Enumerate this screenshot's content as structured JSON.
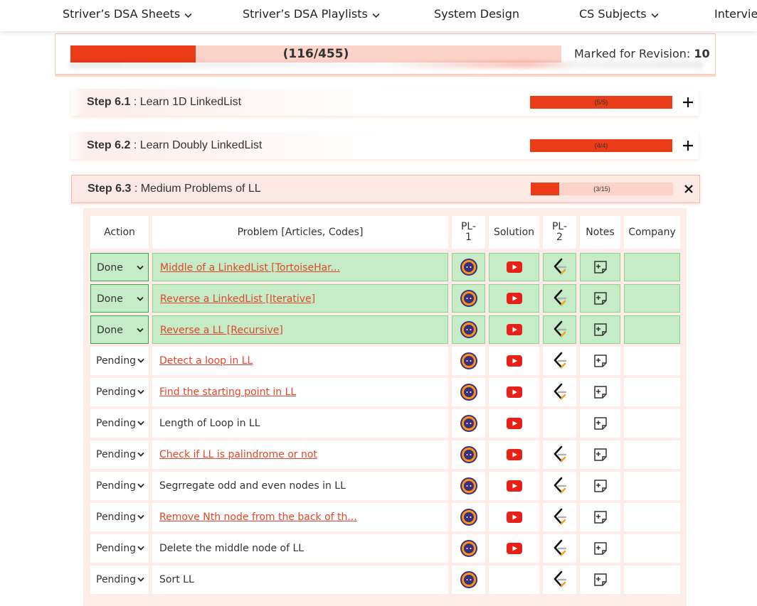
{
  "nav": [
    {
      "label": "Striver’s DSA Sheets",
      "dropdown": true
    },
    {
      "label": "Striver’s DSA Playlists",
      "dropdown": true
    },
    {
      "label": "System Design",
      "dropdown": false
    },
    {
      "label": "CS Subjects",
      "dropdown": true
    },
    {
      "label": "Intervie",
      "dropdown": false
    }
  ],
  "progress": {
    "text": "(116/455)",
    "done": 116,
    "total": 455,
    "revision_label": "Marked for Revision:",
    "revision_count": "10"
  },
  "steps": [
    {
      "num": "Step 6.1",
      "title": ": Learn 1D LinkedList",
      "progress": "(5/5)",
      "fraction": 1.0,
      "expanded": false
    },
    {
      "num": "Step 6.2",
      "title": ": Learn Doubly LinkedList",
      "progress": "(4/4)",
      "fraction": 1.0,
      "expanded": false
    },
    {
      "num": "Step 6.3",
      "title": ": Medium Problems of LL",
      "progress": "(3/15)",
      "fraction": 0.2,
      "expanded": true
    }
  ],
  "table": {
    "headers": {
      "action": "Action",
      "problem": "Problem [Articles, Codes]",
      "pl1": "PL-\n1",
      "solution": "Solution",
      "pl2": "PL-\n2",
      "notes": "Notes",
      "company": "Company"
    },
    "rows": [
      {
        "status": "Done",
        "problem": "Middle of a LinkedList [TortoiseHar...",
        "link": true,
        "pl1": true,
        "solution": true,
        "pl2": true,
        "notes": true
      },
      {
        "status": "Done",
        "problem": "Reverse a LinkedList [Iterative]",
        "link": true,
        "pl1": true,
        "solution": true,
        "pl2": true,
        "notes": true
      },
      {
        "status": "Done",
        "problem": "Reverse a LL [Recursive]",
        "link": true,
        "pl1": true,
        "solution": true,
        "pl2": true,
        "notes": true
      },
      {
        "status": "Pending",
        "problem": "Detect a loop in LL",
        "link": true,
        "pl1": true,
        "solution": true,
        "pl2": true,
        "notes": true
      },
      {
        "status": "Pending",
        "problem": "Find the starting point in LL",
        "link": true,
        "pl1": true,
        "solution": true,
        "pl2": true,
        "notes": true
      },
      {
        "status": "Pending",
        "problem": "Length of Loop in LL",
        "link": false,
        "pl1": true,
        "solution": true,
        "pl2": false,
        "notes": true
      },
      {
        "status": "Pending",
        "problem": "Check if LL is palindrome or not",
        "link": true,
        "pl1": true,
        "solution": true,
        "pl2": true,
        "notes": true
      },
      {
        "status": "Pending",
        "problem": "Segrregate odd and even nodes in LL",
        "link": false,
        "pl1": true,
        "solution": true,
        "pl2": true,
        "notes": true
      },
      {
        "status": "Pending",
        "problem": "Remove Nth node from the back of th...",
        "link": true,
        "pl1": true,
        "solution": true,
        "pl2": true,
        "notes": true
      },
      {
        "status": "Pending",
        "problem": "Delete the middle node of LL",
        "link": false,
        "pl1": true,
        "solution": true,
        "pl2": true,
        "notes": true
      },
      {
        "status": "Pending",
        "problem": "Sort LL",
        "link": false,
        "pl1": true,
        "solution": false,
        "pl2": true,
        "notes": true
      }
    ]
  },
  "icons": {
    "pl1": "coding-ninjas-icon",
    "solution": "youtube-icon",
    "pl2": "leetcode-icon",
    "notes": "add-note-icon",
    "dropdown": "chevron-down-icon"
  },
  "colors": {
    "accent": "#ea3c17",
    "accent_light": "#fbd3c9",
    "done_bg": "#c5ecc6",
    "done_border": "#3fa34a",
    "link": "#e3462a",
    "youtube": "#e62117",
    "ninja_bg": "#3a2f7a",
    "ninja_ring": "#f7931e"
  }
}
